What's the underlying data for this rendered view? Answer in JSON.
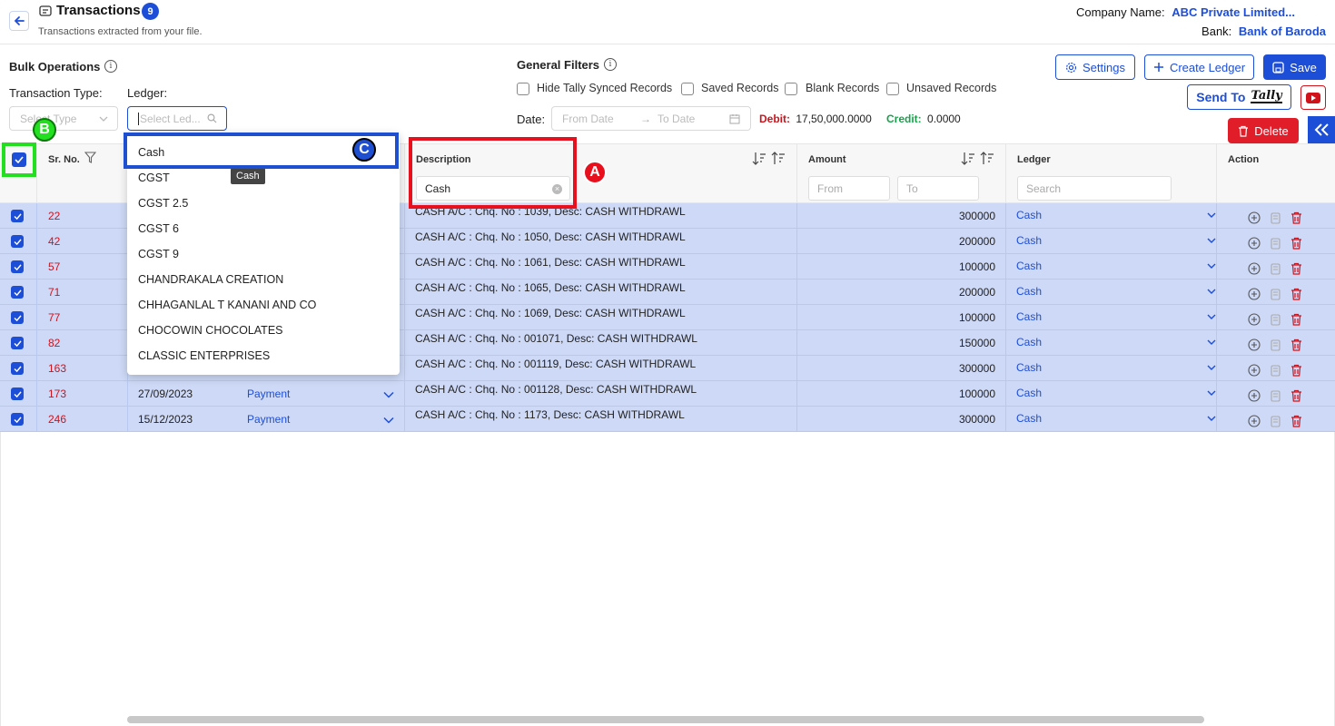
{
  "header": {
    "title": "Transactions",
    "count": "9",
    "subtitle": "Transactions extracted from your file.",
    "company_label": "Company Name:",
    "company_value": "ABC Private Limited...",
    "bank_label": "Bank:",
    "bank_value": "Bank of Baroda"
  },
  "bulk": {
    "title": "Bulk Operations",
    "type_label": "Transaction Type:",
    "type_placeholder": "Select Type",
    "ledger_label": "Ledger:",
    "ledger_placeholder": "Select Led..."
  },
  "filters": {
    "title": "General Filters",
    "checkboxes": [
      "Hide Tally Synced Records",
      "Saved Records",
      "Blank Records",
      "Unsaved Records"
    ],
    "date_label": "Date:",
    "from_date": "From Date",
    "to_date": "To Date",
    "debit_label": "Debit:",
    "debit_value": "17,50,000.0000",
    "credit_label": "Credit:",
    "credit_value": "0.0000"
  },
  "toolbar": {
    "settings": "Settings",
    "create_ledger": "Create Ledger",
    "save": "Save",
    "send_to": "Send To",
    "tally": "Tally",
    "delete": "Delete"
  },
  "table": {
    "headers": {
      "sr": "Sr. No.",
      "description": "Description",
      "amount": "Amount",
      "ledger": "Ledger",
      "action": "Action"
    },
    "description_filter": "Cash",
    "amount_from": "From",
    "amount_to": "To",
    "ledger_search": "Search",
    "rows": [
      {
        "sr": "22",
        "date": "",
        "type": "",
        "desc": "CASH A/C : Chq. No : 1039, Desc: CASH WITHDRAWL",
        "amount": "300000",
        "ledger": "Cash"
      },
      {
        "sr": "42",
        "date": "",
        "type": "",
        "desc": "CASH A/C : Chq. No : 1050, Desc: CASH WITHDRAWL",
        "amount": "200000",
        "ledger": "Cash"
      },
      {
        "sr": "57",
        "date": "",
        "type": "",
        "desc": "CASH A/C : Chq. No : 1061, Desc: CASH WITHDRAWL",
        "amount": "100000",
        "ledger": "Cash"
      },
      {
        "sr": "71",
        "date": "",
        "type": "",
        "desc": "CASH A/C : Chq. No : 1065, Desc: CASH WITHDRAWL",
        "amount": "200000",
        "ledger": "Cash"
      },
      {
        "sr": "77",
        "date": "",
        "type": "",
        "desc": "CASH A/C : Chq. No : 1069, Desc: CASH WITHDRAWL",
        "amount": "100000",
        "ledger": "Cash"
      },
      {
        "sr": "82",
        "date": "",
        "type": "",
        "desc": "CASH A/C : Chq. No : 001071, Desc: CASH WITHDRAWL",
        "amount": "150000",
        "ledger": "Cash"
      },
      {
        "sr": "163",
        "date": "",
        "type": "",
        "desc": "CASH A/C : Chq. No : 001119, Desc: CASH WITHDRAWL",
        "amount": "300000",
        "ledger": "Cash"
      },
      {
        "sr": "173",
        "date": "27/09/2023",
        "type": "Payment",
        "desc": "CASH A/C : Chq. No : 001128, Desc: CASH WITHDRAWL",
        "amount": "100000",
        "ledger": "Cash"
      },
      {
        "sr": "246",
        "date": "15/12/2023",
        "type": "Payment",
        "desc": "CASH A/C : Chq. No : 1173, Desc: CASH WITHDRAWL",
        "amount": "300000",
        "ledger": "Cash"
      }
    ]
  },
  "dropdown": {
    "items": [
      "Cash",
      "CGST",
      "CGST 2.5",
      "CGST 6",
      "CGST 9",
      "CHANDRAKALA CREATION",
      "CHHAGANLAL T KANANI AND CO",
      "CHOCOWIN CHOCOLATES",
      "CLASSIC ENTERPRISES"
    ],
    "tooltip": "Cash"
  },
  "annotations": {
    "a": "A",
    "b": "B",
    "c": "C"
  },
  "colors": {
    "primary": "#1d4ed8",
    "danger": "#d1121b",
    "row_selected": "#cdd9f6",
    "marker_red": "#e8101d",
    "marker_green": "#22e01f",
    "marker_blue": "#1d4fd0"
  }
}
